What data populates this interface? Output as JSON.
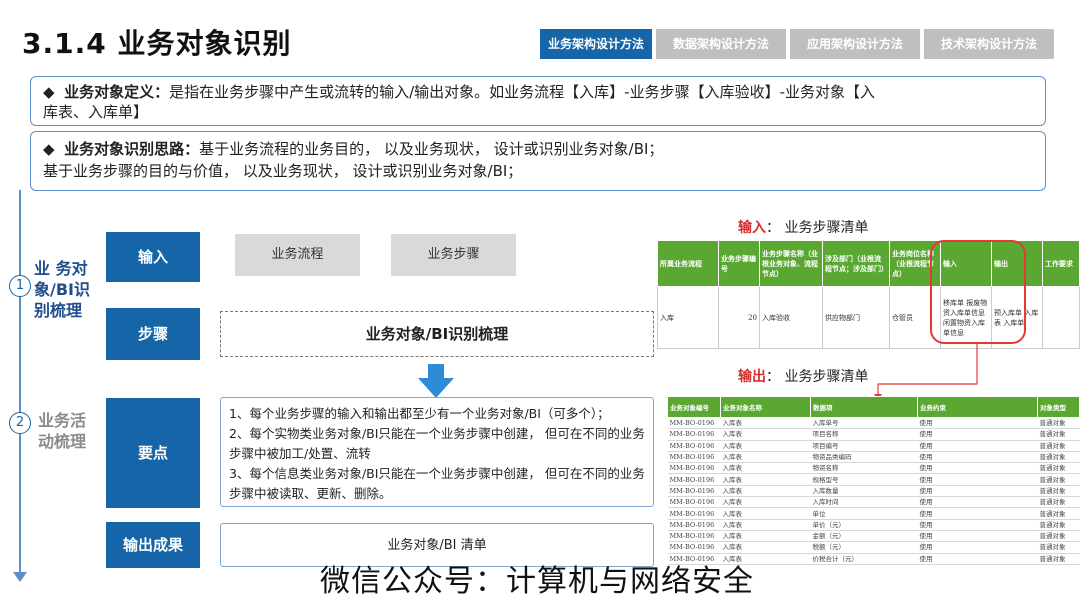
{
  "title": "3.1.4 业务对象识别",
  "tabs": [
    {
      "label": "业务架构设计方法",
      "active": true
    },
    {
      "label": "数据架构设计方法",
      "active": false
    },
    {
      "label": "应用架构设计方法",
      "active": false
    },
    {
      "label": "技术架构设计方法",
      "active": false
    }
  ],
  "definition": {
    "bullet": "◆",
    "term": "业务对象定义：",
    "text_line1": "是指在业务步骤中产生或流转的输入/输出对象。如业务流程【入库】-业务步骤【入库验收】-业务对象【入",
    "text_line2": "库表、入库单】"
  },
  "approach": {
    "bullet": "◆",
    "term": "业务对象识别思路：",
    "text_line1": "基于业务流程的业务目的， 以及业务现状， 设计或识别业务对象/BI；",
    "text_line2": "基于业务步骤的目的与价值， 以及业务现状， 设计或识别业务对象/BI；"
  },
  "section1": {
    "num": "1",
    "title_lines": [
      "业 务对",
      "象/BI识",
      "别梳理"
    ]
  },
  "section2": {
    "num": "2",
    "title_lines": [
      "业务活",
      "动梳理"
    ]
  },
  "labels": {
    "input": "输入",
    "steps": "步骤",
    "points": "要点",
    "output": "输出成果"
  },
  "inputs": [
    "业务流程",
    "业务步骤"
  ],
  "steps_text": "业务对象/BI识别梳理",
  "points": [
    "1、每个业务步骤的输入和输出都至少有一个业务对象/BI（可多个）；",
    "2、每个实物类业务对象/BI只能在一个业务步骤中创建， 但可在不同的业务步骤中被加工/处置、流转",
    "3、每个信息类业务对象/BI只能在一个业务步骤中创建， 但可在不同的业务步骤中被读取、更新、删除。"
  ],
  "output_text": "业务对象/BI 清单",
  "input_list_label": {
    "prefix": "输入",
    "suffix": "：  业务步骤清单"
  },
  "output_list_label": {
    "prefix": "输出",
    "suffix": "：  业务步骤清单"
  },
  "steps_table": {
    "headers": [
      "所属业务流程",
      "业务步骤编号",
      "业务步骤名称（业根业务对象、流程节点）",
      "涉及部门（业根流程节点；涉及部门）",
      "业务岗位名称（业根流程节点）",
      "输入",
      "输出",
      "工作要求"
    ],
    "row": [
      "入库",
      "20",
      "入库验收",
      "供应物部门",
      "仓管员",
      "移库单 报废物资入库单信息 闲置物资入库单信息",
      "预入库单 入库表 入库单",
      ""
    ]
  },
  "bo_table": {
    "headers": [
      "业务对象编号",
      "业务对象名称",
      "数据项",
      "业务约束",
      "对象类型"
    ],
    "rows": [
      [
        "MM-BO-0196",
        "入库表",
        "入库单号",
        "使用",
        "普通对象"
      ],
      [
        "MM-BO-0196",
        "入库表",
        "项目名称",
        "使用",
        "普通对象"
      ],
      [
        "MM-BO-0196",
        "入库表",
        "项目编号",
        "使用",
        "普通对象"
      ],
      [
        "MM-BO-0196",
        "入库表",
        "物资品类编码",
        "使用",
        "普通对象"
      ],
      [
        "MM-BO-0196",
        "入库表",
        "物资名称",
        "使用",
        "普通对象"
      ],
      [
        "MM-BO-0196",
        "入库表",
        "规格型号",
        "使用",
        "普通对象"
      ],
      [
        "MM-BO-0196",
        "入库表",
        "入库数量",
        "使用",
        "普通对象"
      ],
      [
        "MM-BO-0196",
        "入库表",
        "入库时间",
        "使用",
        "普通对象"
      ],
      [
        "MM-BO-0196",
        "入库表",
        "单位",
        "使用",
        "普通对象"
      ],
      [
        "MM-BO-0196",
        "入库表",
        "单价（元）",
        "使用",
        "普通对象"
      ],
      [
        "MM-BO-0196",
        "入库表",
        "金额（元）",
        "使用",
        "普通对象"
      ],
      [
        "MM-BO-0196",
        "入库表",
        "税额（元）",
        "使用",
        "普通对象"
      ],
      [
        "MM-BO-0196",
        "入库表",
        "价税合计（元）",
        "使用",
        "普通对象"
      ]
    ]
  },
  "watermark": "微信公众号：计算机与网络安全"
}
